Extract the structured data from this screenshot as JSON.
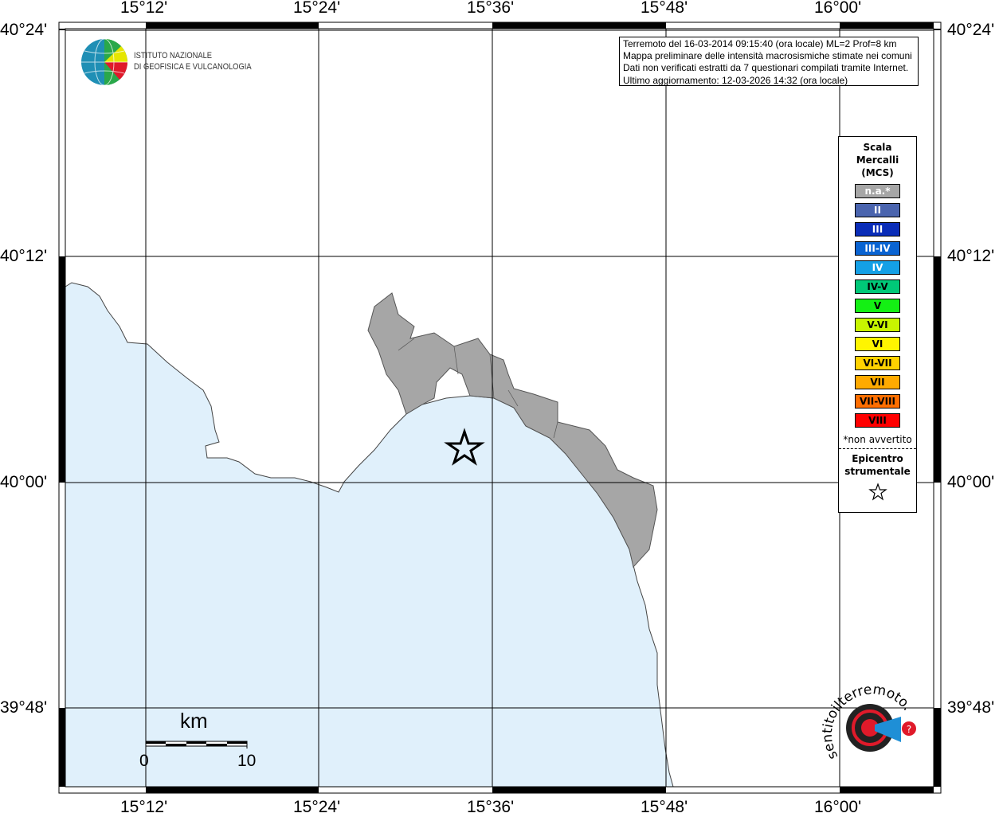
{
  "map": {
    "lon_ticks": [
      "15°12'",
      "15°24'",
      "15°36'",
      "15°48'",
      "16°00'"
    ],
    "lat_ticks": [
      "40°24'",
      "40°12'",
      "40°00'",
      "39°48'"
    ],
    "sea_color": "#e0f0fb",
    "land_color": "#a6a6a6",
    "epicenter_icon": "star-outline-icon"
  },
  "info": {
    "line1": "Terremoto del 16-03-2014 09:15:40 (ora locale) ML=2 Prof=8 km",
    "line2": "Mappa preliminare delle intensità macrosismiche stimate nei comuni",
    "line3": "Dati non verificati estratti da 7 questionari compilati tramite Internet.",
    "line4": "Ultimo aggiornamento: 12-03-2026 14:32 (ora locale)"
  },
  "logo": {
    "ingv_line1": "ISTITUTO NAZIONALE",
    "ingv_line2": "DI GEOFISICA E VULCANOLOGIA",
    "hsi": "www.haisentitoilterremoto.it"
  },
  "legend": {
    "title1": "Scala",
    "title2": "Mercalli",
    "title3": "(MCS)",
    "items": [
      {
        "label": "n.a.*",
        "color": "#a6a6a6",
        "text": "#ffffff"
      },
      {
        "label": "II",
        "color": "#4a64ae",
        "text": "#ffffff"
      },
      {
        "label": "III",
        "color": "#0a2db8",
        "text": "#ffffff"
      },
      {
        "label": "III-IV",
        "color": "#0a64d2",
        "text": "#ffffff"
      },
      {
        "label": "IV",
        "color": "#14a0e6",
        "text": "#ffffff"
      },
      {
        "label": "IV-V",
        "color": "#00c878",
        "text": "#000000"
      },
      {
        "label": "V",
        "color": "#14f014",
        "text": "#000000"
      },
      {
        "label": "V-VI",
        "color": "#c8f500",
        "text": "#000000"
      },
      {
        "label": "VI",
        "color": "#fff500",
        "text": "#000000"
      },
      {
        "label": "VI-VII",
        "color": "#ffd200",
        "text": "#000000"
      },
      {
        "label": "VII",
        "color": "#ffaa00",
        "text": "#000000"
      },
      {
        "label": "VII-VIII",
        "color": "#ff6e00",
        "text": "#000000"
      },
      {
        "label": "VIII",
        "color": "#ff0000",
        "text": "#000000"
      }
    ],
    "note": "*non avvertito",
    "epi1": "Epicentro",
    "epi2": "strumentale"
  },
  "scalebar": {
    "unit": "km",
    "start": "0",
    "end": "10"
  }
}
